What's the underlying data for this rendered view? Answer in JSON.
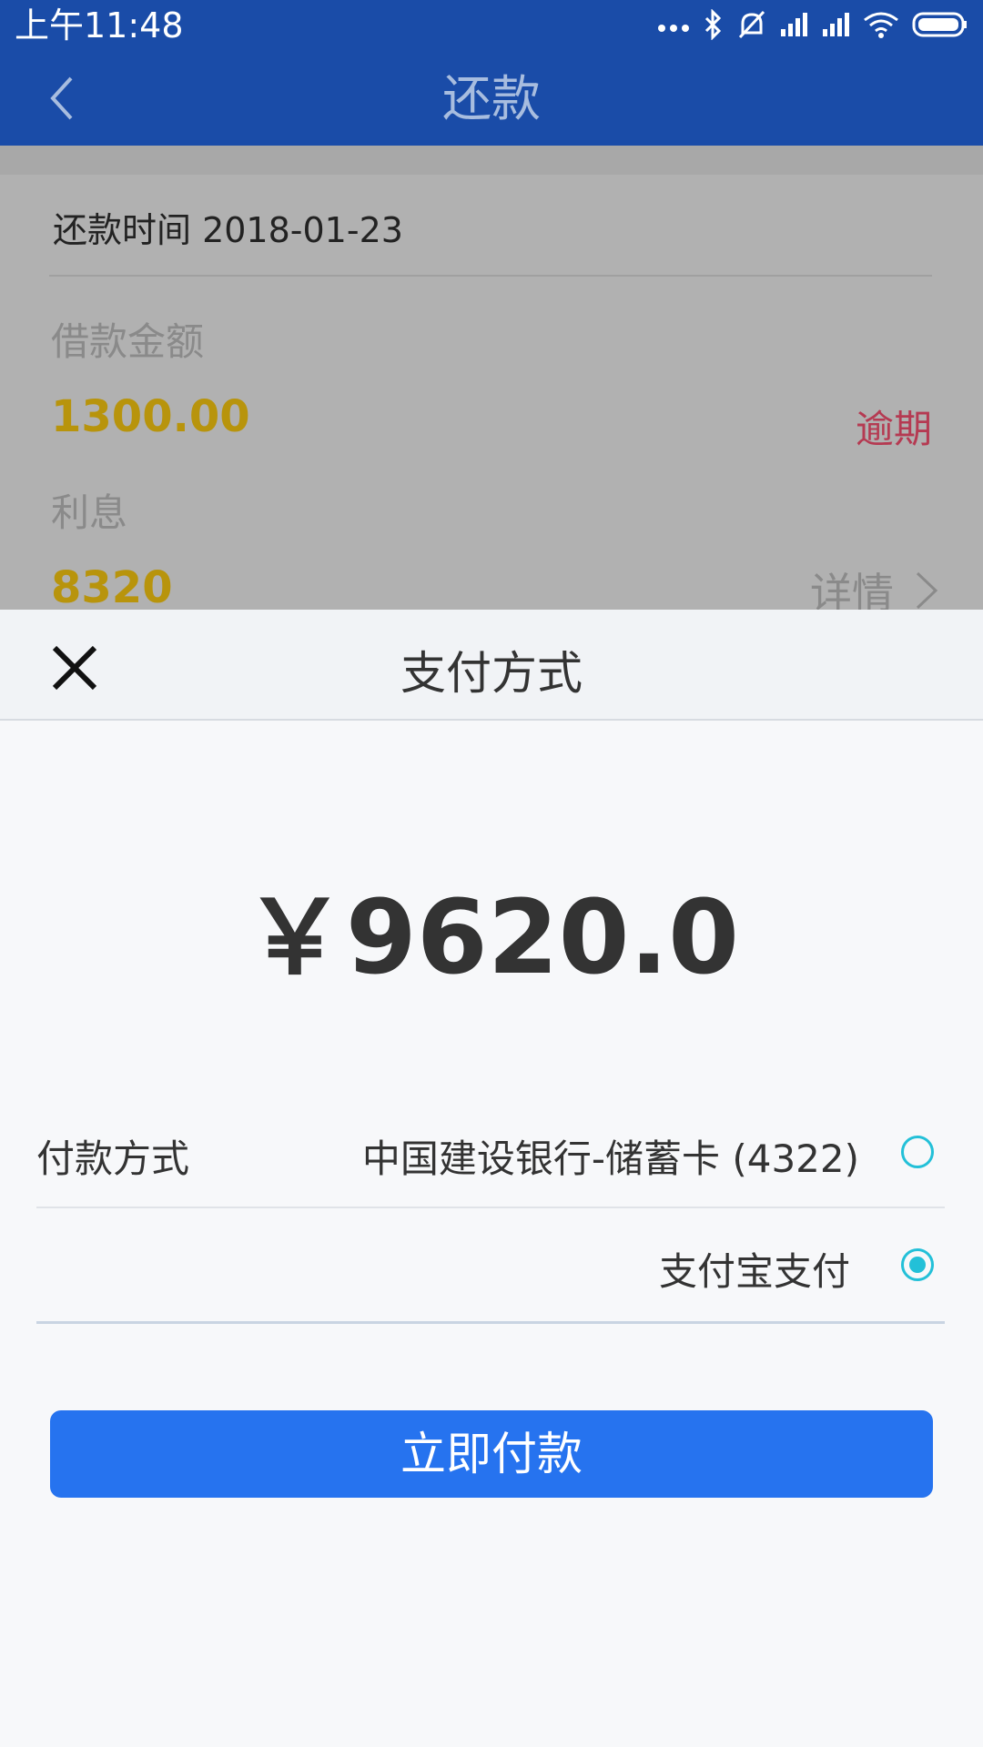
{
  "status_bar": {
    "time": "上午11:48",
    "icons": [
      "more-icon",
      "bluetooth-icon",
      "mute-icon",
      "signal-icon",
      "signal-icon",
      "wifi-icon",
      "battery-icon"
    ]
  },
  "app_bar": {
    "title": "还款"
  },
  "background": {
    "repay_time": "还款时间  2018-01-23",
    "loan_amount_label": "借款金额",
    "loan_amount_value": "1300.00",
    "overdue_label": "逾期",
    "interest_label": "利息",
    "interest_value": "8320",
    "detail_label": "详情"
  },
  "payment_sheet": {
    "title": "支付方式",
    "amount": "￥9620.0",
    "payment_method_label": "付款方式",
    "options": [
      {
        "label": "中国建设银行-储蓄卡 (4322)",
        "selected": false
      },
      {
        "label": "支付宝支付",
        "selected": true
      }
    ],
    "pay_button": "立即付款"
  },
  "colors": {
    "primary": "#1a4ca8",
    "accent_button": "#2673ef",
    "radio": "#23c0d8",
    "gold_value": "#b8940c",
    "overdue_red": "#b53a52"
  }
}
